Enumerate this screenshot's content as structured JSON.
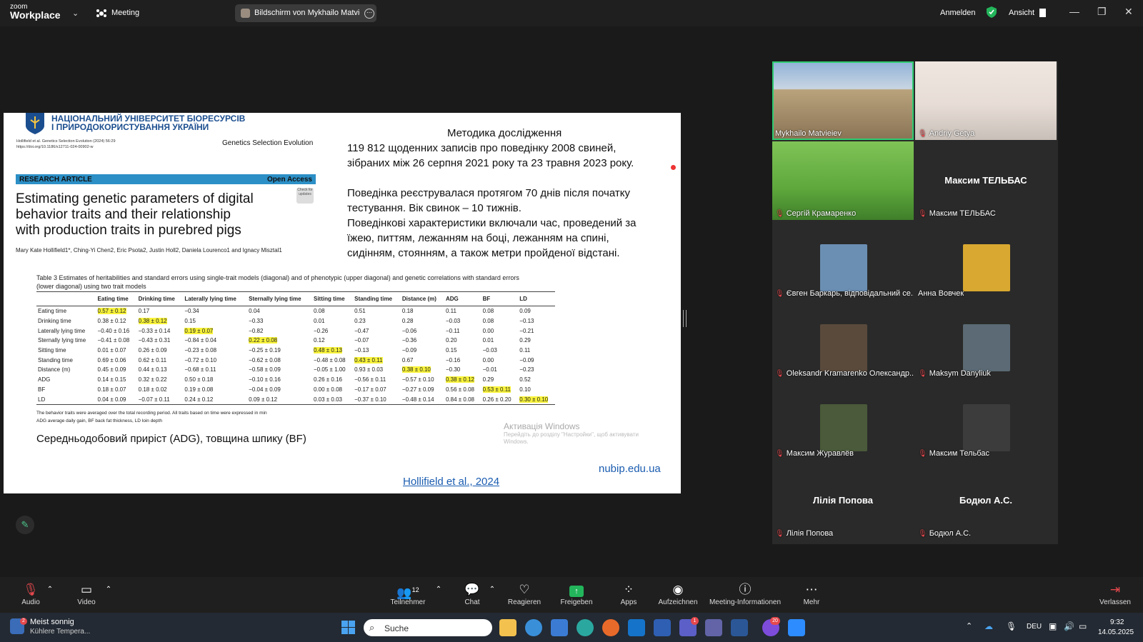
{
  "topbar": {
    "logo_top": "zoom",
    "logo_bottom": "Workplace",
    "meeting_label": "Meeting",
    "share_label": "Bildschirm von Mykhailo Matvieiev",
    "signin": "Anmelden",
    "view": "Ansicht"
  },
  "slide": {
    "uni_line1": "НАЦІОНАЛЬНИЙ УНІВЕРСИТЕТ БІОРЕСУРСІВ",
    "uni_line2": "І ПРИРОДОКОРИСТУВАННЯ УКРАЇНИ",
    "citation": "Hollifield et al. Genetics Selection Evolution        (2024) 56:29",
    "doi": "https://doi.org/10.1186/s12711-024-00902-w",
    "journal": "Genetics Selection Evolution",
    "research_article": "RESEARCH ARTICLE",
    "open_access": "Open Access",
    "badge": "Check for updates",
    "title_lines": [
      "Estimating genetic parameters of digital",
      "behavior traits and their relationship",
      "with production traits in purebred pigs"
    ],
    "authors": "Mary Kate Hollifield1*, Ching-Yi Chen2, Eric Psota2, Justin Holl2, Daniela Lourenco1 and Ignacy Misztal1",
    "table_caption_1": "Table 3  Estimates of heritabilities and standard errors using single-trait models (diagonal) and of phenotypic (upper diagonal) and genetic correlations with standard errors",
    "table_caption_2": "(lower diagonal) using two trait models",
    "table": {
      "headers": [
        "",
        "Eating time",
        "Drinking time",
        "Laterally lying time",
        "Sternally lying time",
        "Sitting time",
        "Standing time",
        "Distance (m)",
        "ADG",
        "BF",
        "LD"
      ],
      "rows": [
        [
          "Eating time",
          "0.57 ± 0.12",
          "0.17",
          "−0.34",
          "0.04",
          "0.08",
          "0.51",
          "0.18",
          "0.11",
          "0.08",
          "0.09"
        ],
        [
          "Drinking time",
          "0.38 ± 0.12",
          "0.38 ± 0.12",
          "0.15",
          "−0.33",
          "0.01",
          "0.23",
          "0.28",
          "−0.03",
          "0.08",
          "−0.13"
        ],
        [
          "Laterally lying time",
          "−0.40 ± 0.16",
          "−0.33 ± 0.14",
          "0.19 ± 0.07",
          "−0.82",
          "−0.26",
          "−0.47",
          "−0.06",
          "−0.11",
          "0.00",
          "−0.21"
        ],
        [
          "Sternally lying time",
          "−0.41 ± 0.08",
          "−0.43 ± 0.31",
          "−0.84 ± 0.04",
          "0.22 ± 0.08",
          "0.12",
          "−0.07",
          "−0.36",
          "0.20",
          "0.01",
          "0.29"
        ],
        [
          "Sitting time",
          "0.01 ± 0.07",
          "0.26 ± 0.09",
          "−0.23 ± 0.08",
          "−0.25 ± 0.19",
          "0.48 ± 0.13",
          "−0.13",
          "−0.09",
          "0.15",
          "−0.03",
          "0.11"
        ],
        [
          "Standing time",
          "0.69 ± 0.06",
          "0.62 ± 0.11",
          "−0.72 ± 0.10",
          "−0.62 ± 0.08",
          "−0.48 ± 0.08",
          "0.43 ± 0.11",
          "0.67",
          "−0.16",
          "0.00",
          "−0.09"
        ],
        [
          "Distance (m)",
          "0.45 ± 0.09",
          "0.44 ± 0.13",
          "−0.68 ± 0.11",
          "−0.58 ± 0.09",
          "−0.05 ± 1.00",
          "0.93 ± 0.03",
          "0.38 ± 0.10",
          "−0.30",
          "−0.01",
          "−0.23"
        ],
        [
          "ADG",
          "0.14 ± 0.15",
          "0.32 ± 0.22",
          "0.50 ± 0.18",
          "−0.10 ± 0.16",
          "0.26 ± 0.16",
          "−0.56 ± 0.11",
          "−0.57 ± 0.10",
          "0.38 ± 0.12",
          "0.29",
          "0.52"
        ],
        [
          "BF",
          "0.18 ± 0.07",
          "0.18 ± 0.02",
          "0.19 ± 0.08",
          "−0.04 ± 0.09",
          "0.00 ± 0.08",
          "−0.17 ± 0.07",
          "−0.27 ± 0.09",
          "0.56 ± 0.08",
          "0.53 ± 0.11",
          "0.10"
        ],
        [
          "LD",
          "0.04 ± 0.09",
          "−0.07 ± 0.11",
          "0.24 ± 0.12",
          "0.09 ± 0.12",
          "0.03 ± 0.03",
          "−0.37 ± 0.10",
          "−0.48 ± 0.14",
          "0.84 ± 0.08",
          "0.26 ± 0.20",
          "0.30 ± 0.10"
        ]
      ]
    },
    "footnote_1": "The behavior traits were averaged over the total recording period. All traits based on time were expressed in min",
    "footnote_2": "ADG average daily gain, BF back fat thickness, LD loin depth",
    "adg_line": "Середньодобовий приріст (ADG), товщина шпику (BF)",
    "method_title": "Методика дослідження",
    "method_lines": [
      "119 812 щоденних записів про поведінку 2008 свиней,",
      "зібраних між 26 серпня 2021 року та 23 травня 2023 року.",
      "Поведінка реєструвалася протягом 70 днів після початку",
      "тестування. Вік свинок – 10 тижнів.",
      " Поведінкові характеристики включали час, проведений за",
      "їжею, питтям, лежанням на боці, лежанням на спині,",
      "сидінням, стоянням, а також метри пройденої відстані."
    ],
    "activate_1": "Активація Windows",
    "activate_2": "Перейдіть до розділу \"Настройки\", щоб активувати",
    "activate_3": "Windows.",
    "site": "nubip.edu.ua",
    "reference": "Hollifield et al., 2024"
  },
  "gallery": [
    {
      "name": "Mykhailo Matvieiev",
      "muted": false,
      "style": "video-building"
    },
    {
      "name": "Andriy Getya",
      "muted": true,
      "style": "video-office"
    },
    {
      "name": "Сергій Крамаренко",
      "muted": true,
      "style": "video-green"
    },
    {
      "name": "Максим ТЕЛЬБАС",
      "muted": true,
      "style": "name-only",
      "big": "Максим ТЕЛЬБАС"
    },
    {
      "name": "Євген Баркарь, відповідальний се...",
      "muted": true,
      "style": "avatar"
    },
    {
      "name": "Анна Вовчек",
      "muted": false,
      "style": "avatar"
    },
    {
      "name": "Oleksandr Kramarenko Олександр...",
      "muted": true,
      "style": "avatar"
    },
    {
      "name": "Maksym Danyliuk",
      "muted": true,
      "style": "avatar"
    },
    {
      "name": "Максим Журавлёв",
      "muted": true,
      "style": "avatar"
    },
    {
      "name": "Максим Тельбас",
      "muted": true,
      "style": "avatar"
    },
    {
      "name": "Лілія Попова",
      "muted": true,
      "style": "name-only",
      "big": "Лілія Попова"
    },
    {
      "name": "Бодюл А.С.",
      "muted": true,
      "style": "name-only",
      "big": "Бодюл А.С."
    }
  ],
  "toolbar": {
    "audio": "Audio",
    "video": "Video",
    "participants": "Teilnehmer",
    "participants_count": "12",
    "chat": "Chat",
    "react": "Reagieren",
    "share": "Freigeben",
    "apps": "Apps",
    "record": "Aufzeichnen",
    "info": "Meeting-Informationen",
    "more": "Mehr",
    "leave": "Verlassen"
  },
  "taskbar": {
    "weather_title": "Meist sonnig",
    "weather_sub": "Kühlere Tempera...",
    "weather_badge": "2",
    "search": "Suche",
    "teams_badge": "1",
    "viber_badge": "20",
    "lang": "DEU",
    "time": "9:32",
    "date": "14.05.2025"
  },
  "colors": {
    "accent_green": "#23b55b",
    "slide_blue": "#1a5cb0",
    "highlight": "#f8f33a",
    "speaker_border": "#2ecc71"
  }
}
